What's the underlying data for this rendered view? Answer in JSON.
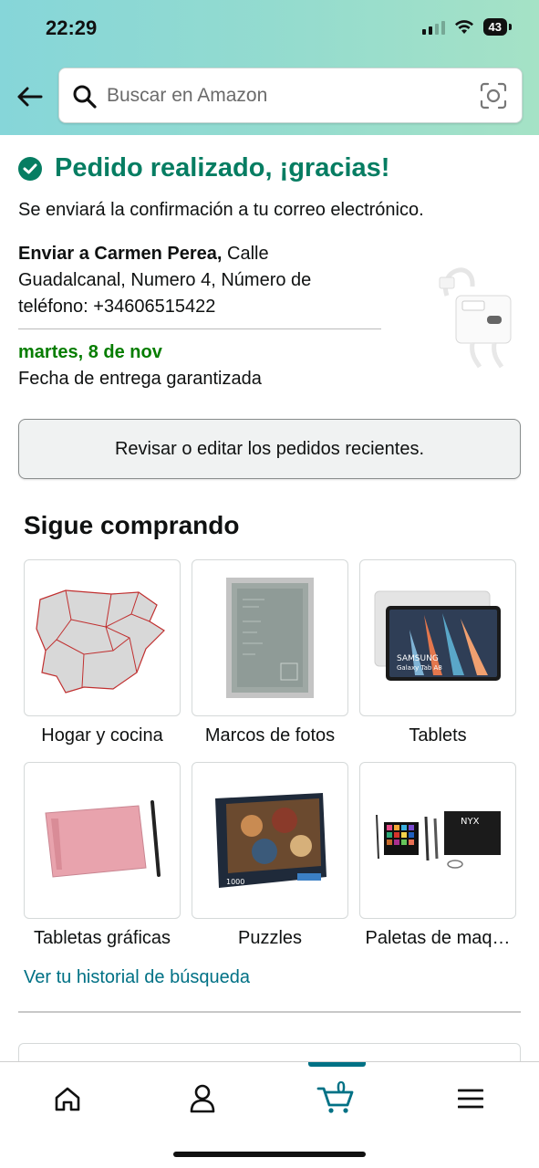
{
  "status_bar": {
    "time": "22:29",
    "battery": "43",
    "icons": [
      "signal-icon",
      "wifi-icon",
      "battery-icon"
    ]
  },
  "header": {
    "back_icon": "back-arrow-icon",
    "search_placeholder": "Buscar en Amazon",
    "search_value": "",
    "camera_icon": "camera-scan-icon",
    "gradient": [
      "#86d6d9",
      "#a5e2c6"
    ]
  },
  "confirmation": {
    "title": "Pedido realizado, ¡gracias!",
    "email_note": "Se enviará la confirmación a tu correo electrónico.",
    "ship_to_bold": "Enviar a Carmen Perea,",
    "ship_to_address": " Calle Guadalcanal, Numero 4, Número de teléfono: +34606515422",
    "delivery_date": "martes, 8 de nov",
    "delivery_note": "Fecha de entrega garantizada",
    "review_button": "Revisar o editar los pedidos recientes.",
    "accent_color": "#067d62"
  },
  "keep_shopping": {
    "title": "Sigue comprando",
    "tiles": [
      {
        "label": "Hogar y cocina",
        "image": "spain-map"
      },
      {
        "label": "Marcos de fotos",
        "image": "photo-frame"
      },
      {
        "label": "Tablets",
        "image": "samsung-tablet"
      },
      {
        "label": "Tabletas gráficas",
        "image": "pink-graphics-tablet"
      },
      {
        "label": "Puzzles",
        "image": "puzzle-box"
      },
      {
        "label": "Paletas de maq…",
        "image": "makeup-palette"
      }
    ],
    "history_link": "Ver tu historial de búsqueda"
  },
  "product_image_text": {
    "tablet_brand": "SAMSUNG",
    "tablet_model": "Galaxy Tab A8",
    "puzzle_pieces": "1000",
    "makeup_brand": "NYX"
  },
  "bottom_nav": {
    "items": [
      {
        "name": "home",
        "icon": "home-icon"
      },
      {
        "name": "account",
        "icon": "person-icon"
      },
      {
        "name": "cart",
        "icon": "cart-icon"
      },
      {
        "name": "menu",
        "icon": "menu-icon"
      }
    ],
    "cart_count": "0",
    "active": "cart",
    "active_color": "#007185"
  }
}
